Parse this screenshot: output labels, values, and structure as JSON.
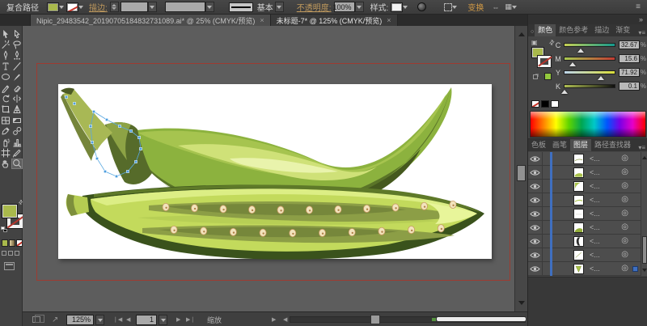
{
  "control_bar": {
    "selection_type": "复合路径",
    "stroke_label": "描边:",
    "brush_definition": "基本",
    "opacity_label": "不透明度:",
    "opacity_value": "100%",
    "style_label": "样式:",
    "transform_label": "变换",
    "fill_color": "#a9b94c",
    "menu_icon": "≡"
  },
  "document_tabs": [
    {
      "title": "Nipic_29483542_20190705184832731089.ai* @ 25% (CMYK/预览)",
      "close_label": "×",
      "active": false
    },
    {
      "title": "未标题-7* @ 125% (CMYK/预览)",
      "close_label": "×",
      "active": true
    }
  ],
  "toolbar": {
    "tools": [
      {
        "name": "selection"
      },
      {
        "name": "direct-selection"
      },
      {
        "name": "magic-wand"
      },
      {
        "name": "lasso"
      },
      {
        "name": "pen"
      },
      {
        "name": "curvature"
      },
      {
        "name": "type"
      },
      {
        "name": "line-segment"
      },
      {
        "name": "ellipse"
      },
      {
        "name": "paintbrush"
      },
      {
        "name": "pencil"
      },
      {
        "name": "eraser"
      },
      {
        "name": "rotate"
      },
      {
        "name": "width"
      },
      {
        "name": "free-transform"
      },
      {
        "name": "perspective-grid"
      },
      {
        "name": "mesh"
      },
      {
        "name": "gradient"
      },
      {
        "name": "eyedropper"
      },
      {
        "name": "blend"
      },
      {
        "name": "symbol-sprayer"
      },
      {
        "name": "column-graph"
      },
      {
        "name": "artboard"
      },
      {
        "name": "slice"
      },
      {
        "name": "hand"
      },
      {
        "name": "zoom",
        "active": true
      }
    ],
    "fill_color": "#a9b94c"
  },
  "status_bar": {
    "zoom_level": "125%",
    "artboard_number": "1",
    "status_text": "缩放"
  },
  "dock": {
    "collapse_icon": "»"
  },
  "color_panel": {
    "tabs": [
      {
        "label": "颜色",
        "active": true
      },
      {
        "label": "颜色参考",
        "active": false
      },
      {
        "label": "描边",
        "active": false
      },
      {
        "label": "渐变",
        "active": false
      }
    ],
    "sliders": [
      {
        "channel": "C",
        "value": "32.67",
        "pct": 32.67
      },
      {
        "channel": "M",
        "value": "15.6",
        "pct": 15.6
      },
      {
        "channel": "Y",
        "value": "71.92",
        "pct": 71.92
      },
      {
        "channel": "K",
        "value": "0.1",
        "pct": 0.1
      }
    ],
    "unit": "%",
    "fill_color": "#a9b94c"
  },
  "lower_panel": {
    "tabs": [
      {
        "label": "色板",
        "active": false
      },
      {
        "label": "画笔",
        "active": false
      },
      {
        "label": "图层",
        "active": true
      },
      {
        "label": "路径查找器",
        "active": false
      }
    ],
    "layers": [
      {
        "label": "<...",
        "thumb": "wave-thin"
      },
      {
        "label": "<...",
        "thumb": "wave-green"
      },
      {
        "label": "<...",
        "thumb": "arc-tl"
      },
      {
        "label": "<...",
        "thumb": "wave-mid"
      },
      {
        "label": "<...",
        "thumb": "blank"
      },
      {
        "label": "<...",
        "thumb": "wave-thick"
      },
      {
        "label": "<...",
        "thumb": "crescent"
      },
      {
        "label": "<...",
        "thumb": "diag"
      },
      {
        "label": "<...",
        "thumb": "tri",
        "selected": true
      }
    ]
  }
}
